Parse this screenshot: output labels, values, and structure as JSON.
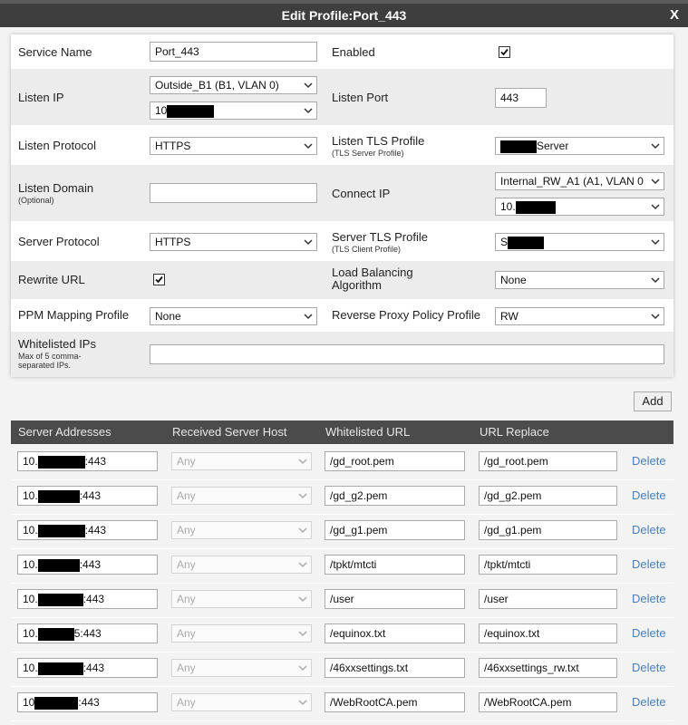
{
  "dialog": {
    "title": "Edit Profile:Port_443",
    "close": "X"
  },
  "form": {
    "service_name": {
      "label": "Service Name",
      "value": "Port_443"
    },
    "enabled": {
      "label": "Enabled",
      "checked": true
    },
    "listen_ip": {
      "label": "Listen IP",
      "interface": "Outside_B1 (B1, VLAN 0)",
      "address_prefix": "10"
    },
    "listen_port": {
      "label": "Listen Port",
      "value": "443"
    },
    "listen_protocol": {
      "label": "Listen Protocol",
      "value": "HTTPS"
    },
    "listen_tls_profile": {
      "label": "Listen TLS Profile",
      "sublabel": "(TLS Server Profile)",
      "value_suffix": "Server"
    },
    "listen_domain": {
      "label": "Listen Domain",
      "sublabel": "(Optional)",
      "value": ""
    },
    "connect_ip": {
      "label": "Connect IP",
      "interface": "Internal_RW_A1 (A1, VLAN 0",
      "address_prefix": "10."
    },
    "server_protocol": {
      "label": "Server Protocol",
      "value": "HTTPS"
    },
    "server_tls_profile": {
      "label": "Server TLS Profile",
      "sublabel": "(TLS Client Profile)",
      "value_prefix": "S"
    },
    "rewrite_url": {
      "label": "Rewrite URL",
      "checked": true
    },
    "load_balancing": {
      "label": "Load Balancing Algorithm",
      "value": "None"
    },
    "ppm_mapping": {
      "label": "PPM Mapping Profile",
      "value": "None"
    },
    "reverse_proxy": {
      "label": "Reverse Proxy Policy Profile",
      "value": "RW"
    },
    "whitelisted_ips": {
      "label": "Whitelisted IPs",
      "sublabel": "Max of 5 comma-separated IPs.",
      "value": ""
    }
  },
  "add_button": "Add",
  "table": {
    "headers": [
      "Server Addresses",
      "Received Server Host",
      "Whitelisted URL",
      "URL Replace"
    ],
    "delete_label": "Delete",
    "host_placeholder": "Any",
    "rows": [
      {
        "addr_prefix": "10.",
        "addr_suffix": ":443",
        "url": "/gd_root.pem",
        "replace": "/gd_root.pem"
      },
      {
        "addr_prefix": "10.",
        "addr_suffix": ":443",
        "url": "/gd_g2.pem",
        "replace": "/gd_g2.pem"
      },
      {
        "addr_prefix": "10.",
        "addr_suffix": ":443",
        "url": "/gd_g1.pem",
        "replace": "/gd_g1.pem"
      },
      {
        "addr_prefix": "10.",
        "addr_suffix": ":443",
        "url": "/tpkt/mtcti",
        "replace": "/tpkt/mtcti"
      },
      {
        "addr_prefix": "10.",
        "addr_suffix": ":443",
        "url": "/user",
        "replace": "/user"
      },
      {
        "addr_prefix": "10.",
        "addr_suffix": "5:443",
        "url": "/equinox.txt",
        "replace": "/equinox.txt"
      },
      {
        "addr_prefix": "10.",
        "addr_suffix": ":443",
        "url": "/46xxsettings.txt",
        "replace": "/46xxsettings_rw.txt"
      },
      {
        "addr_prefix": "10",
        "addr_suffix": ":443",
        "url": "/WebRootCA.pem",
        "replace": "/WebRootCA.pem"
      }
    ]
  }
}
